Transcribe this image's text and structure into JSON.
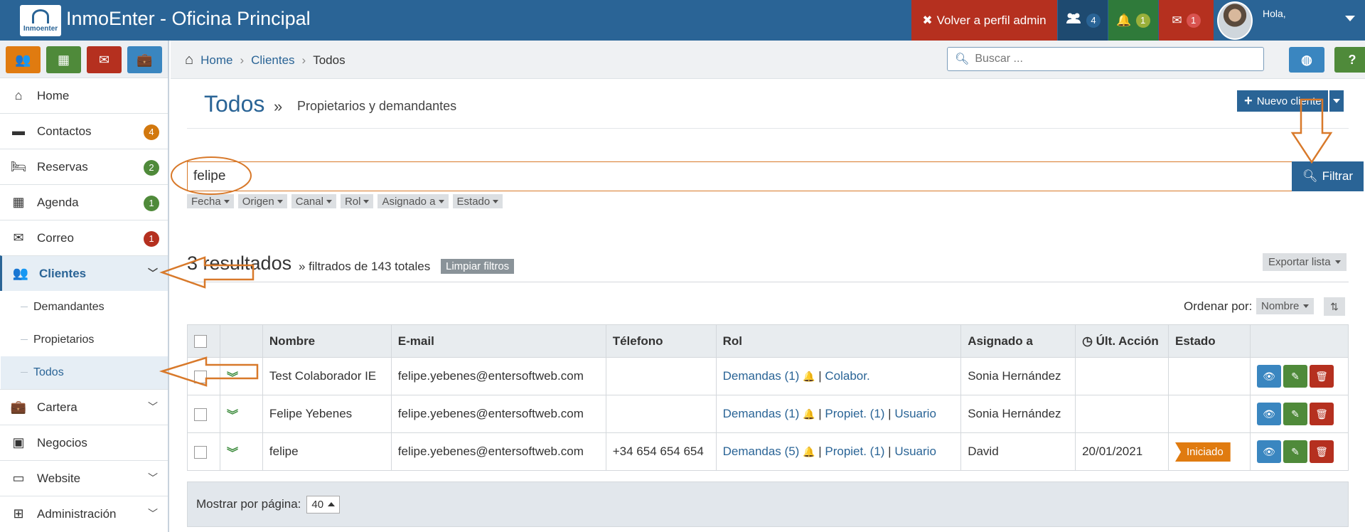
{
  "app": {
    "title": "InmoEnter - Oficina Principal",
    "logo_text": "Inmoenter"
  },
  "topbar": {
    "back_admin": "Volver a perfil admin",
    "users_count": "4",
    "bell_count": "1",
    "mail_count": "1",
    "greeting": "Hola,"
  },
  "quick": [
    "users-icon",
    "calendar-icon",
    "envelope-icon",
    "briefcase-icon"
  ],
  "sidebar": {
    "items": [
      {
        "label": "Home",
        "icon": "home-icon"
      },
      {
        "label": "Contactos",
        "badge": "4",
        "badge_color": "#d2780e",
        "icon": "chat-icon"
      },
      {
        "label": "Reservas",
        "badge": "2",
        "badge_color": "#4f8a3a",
        "icon": "bed-icon"
      },
      {
        "label": "Agenda",
        "badge": "1",
        "badge_color": "#4f8a3a",
        "icon": "calendar-icon"
      },
      {
        "label": "Correo",
        "badge": "1",
        "badge_color": "#b5301f",
        "icon": "envelope-icon"
      },
      {
        "label": "Clientes",
        "icon": "users-icon"
      },
      {
        "label": "Cartera",
        "icon": "briefcase-icon"
      },
      {
        "label": "Negocios",
        "icon": "money-icon"
      },
      {
        "label": "Website",
        "icon": "monitor-icon"
      },
      {
        "label": "Administración",
        "icon": "sitemap-icon"
      }
    ],
    "sub": [
      "Demandantes",
      "Propietarios",
      "Todos"
    ]
  },
  "breadcrumb": {
    "home": "Home",
    "clientes": "Clientes",
    "current": "Todos",
    "search_placeholder": "Buscar ..."
  },
  "page": {
    "title": "Todos",
    "raquo": "»",
    "subtitle": "Propietarios y demandantes",
    "new_client": "Nuevo cliente"
  },
  "filter": {
    "value": "felipe",
    "button": "Filtrar",
    "chips": [
      "Fecha",
      "Origen",
      "Canal",
      "Rol",
      "Asignado a",
      "Estado"
    ]
  },
  "results": {
    "count": "3 resultados",
    "filtered": "» filtrados de 143 totales",
    "clear": "Limpiar filtros",
    "export": "Exportar lista",
    "order_label": "Ordenar por:",
    "order_value": "Nombre"
  },
  "table": {
    "headers": [
      "Nombre",
      "E-mail",
      "Télefono",
      "Rol",
      "Asignado a",
      "Últ. Acción",
      "Estado"
    ],
    "rows": [
      {
        "name": "Test Colaborador IE",
        "email": "felipe.yebenes@entersoftweb.com",
        "phone": "",
        "rol_dem": "Demandas (1)",
        "rol_b": "Colabor.",
        "rol_c": "",
        "assigned": "Sonia Hernández",
        "last": "",
        "state": ""
      },
      {
        "name": "Felipe Yebenes",
        "email": "felipe.yebenes@entersoftweb.com",
        "phone": "",
        "rol_dem": "Demandas (1)",
        "rol_b": "Propiet. (1)",
        "rol_c": "Usuario",
        "assigned": "Sonia Hernández",
        "last": "",
        "state": ""
      },
      {
        "name": "felipe",
        "email": "felipe.yebenes@entersoftweb.com",
        "phone": "+34 654 654 654",
        "rol_dem": "Demandas (5)",
        "rol_b": "Propiet. (1)",
        "rol_c": "Usuario",
        "assigned": "David",
        "last": "20/01/2021",
        "state": "Iniciado"
      }
    ]
  },
  "footer": {
    "label": "Mostrar por página:",
    "value": "40"
  }
}
